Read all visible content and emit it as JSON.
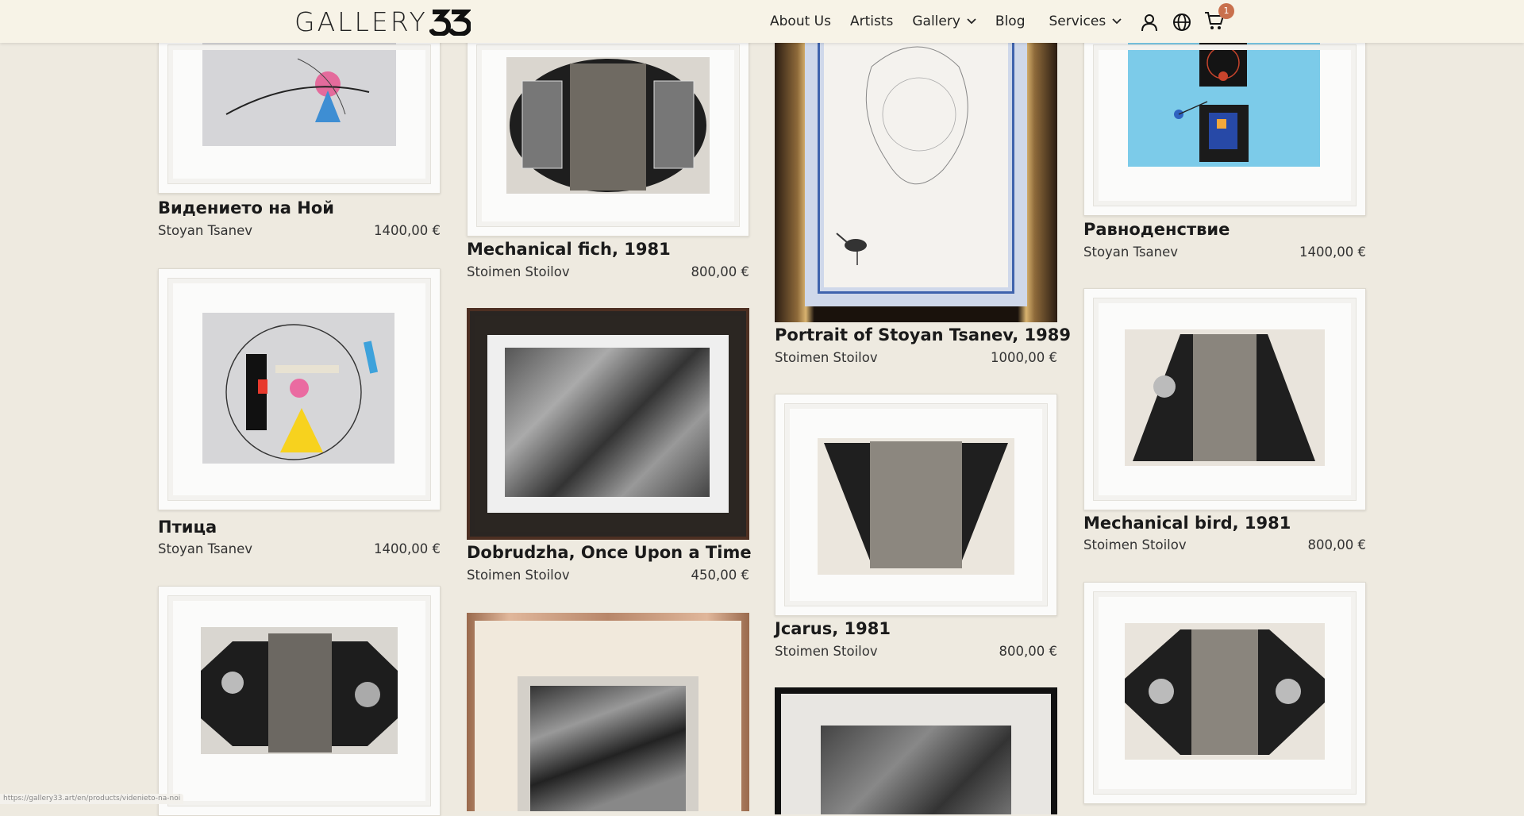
{
  "header": {
    "logo_text": "GALLERY",
    "nav": [
      {
        "label": "About Us"
      },
      {
        "label": "Artists"
      },
      {
        "label": "Gallery"
      },
      {
        "label": "Blog"
      },
      {
        "label": "Services"
      }
    ],
    "cart_count": "1"
  },
  "products": [
    {
      "title": "Видението на Ной",
      "artist": "Stoyan Tsanev",
      "price": "1400,00 €"
    },
    {
      "title": "Mechanical fich, 1981",
      "artist": "Stoimen Stoilov",
      "price": "800,00 €"
    },
    {
      "title": "Portrait of Stoyan Tsanev, 1989",
      "artist": "Stoimen Stoilov",
      "price": "1000,00 €"
    },
    {
      "title": "Равноденствие",
      "artist": "Stoyan Tsanev",
      "price": "1400,00 €"
    },
    {
      "title": "Птица",
      "artist": "Stoyan Tsanev",
      "price": "1400,00 €"
    },
    {
      "title": "Dobrudzha, Once Upon a Time",
      "artist": "Stoimen Stoilov",
      "price": "450,00 €"
    },
    {
      "title": "Jcarus, 1981",
      "artist": "Stoimen Stoilov",
      "price": "800,00 €"
    },
    {
      "title": "Mechanical bird, 1981",
      "artist": "Stoimen Stoilov",
      "price": "800,00 €"
    }
  ],
  "status_url": "https://gallery33.art/en/products/videnieto-na-noi",
  "colors": {
    "background": "#eeeae0",
    "header": "#f7f3e7",
    "badge": "#c9704d"
  }
}
